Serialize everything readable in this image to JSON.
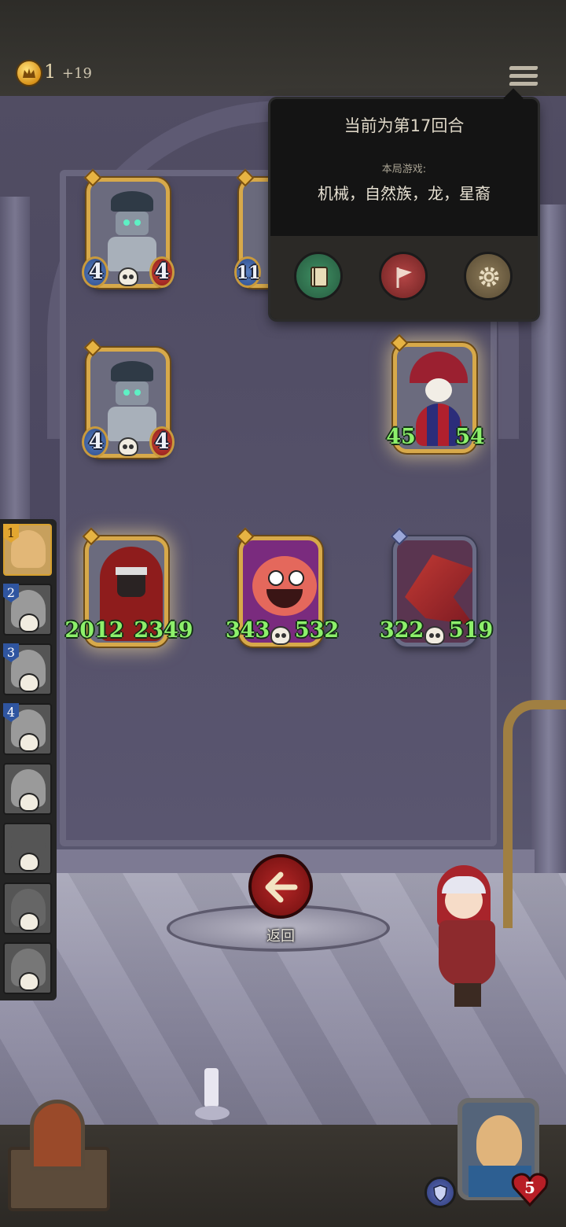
{
  "top_bar": {
    "gold": "1",
    "gold_income": "+19",
    "menu_icon": "hamburger-icon"
  },
  "menu_popup": {
    "round_text": "当前为第17回合",
    "game_label": "本局游戏:",
    "game_tribes": "机械，自然族，龙，星裔",
    "buttons": [
      {
        "name": "book",
        "icon": "book-icon"
      },
      {
        "name": "surrender",
        "icon": "surrender-flag-icon"
      },
      {
        "name": "settings",
        "icon": "gear-icon"
      }
    ]
  },
  "board": {
    "cards": [
      {
        "id": "robot-1",
        "attack": "4",
        "health": "4",
        "buffed": false
      },
      {
        "id": "partial-top",
        "attack": "11",
        "health": "",
        "buffed": false
      },
      {
        "id": "robot-2",
        "attack": "4",
        "health": "4",
        "buffed": false
      },
      {
        "id": "clown",
        "attack": "45",
        "health": "54",
        "buffed": true
      },
      {
        "id": "assassin",
        "attack": "2012",
        "health": "2349",
        "buffed": true
      },
      {
        "id": "pig-demon",
        "attack": "343",
        "health": "532",
        "buffed": true
      },
      {
        "id": "dragon",
        "attack": "322",
        "health": "519",
        "buffed": true
      }
    ]
  },
  "roster": {
    "players": [
      {
        "rank": "1",
        "eliminated": false,
        "is_self": true
      },
      {
        "rank": "2",
        "eliminated": true
      },
      {
        "rank": "3",
        "eliminated": true
      },
      {
        "rank": "4",
        "eliminated": true
      },
      {
        "rank": "",
        "eliminated": true
      },
      {
        "rank": "",
        "eliminated": true
      },
      {
        "rank": "",
        "eliminated": true
      },
      {
        "rank": "",
        "eliminated": true
      }
    ]
  },
  "return_button": {
    "label": "返回",
    "icon": "arrow-left-icon"
  },
  "player": {
    "health": "5",
    "armor_icon": "shield-icon"
  },
  "colors": {
    "gold": "#d7a94a",
    "buff_green": "#8df06b",
    "popup_bg": "#141414",
    "return_red": "#b52626"
  }
}
